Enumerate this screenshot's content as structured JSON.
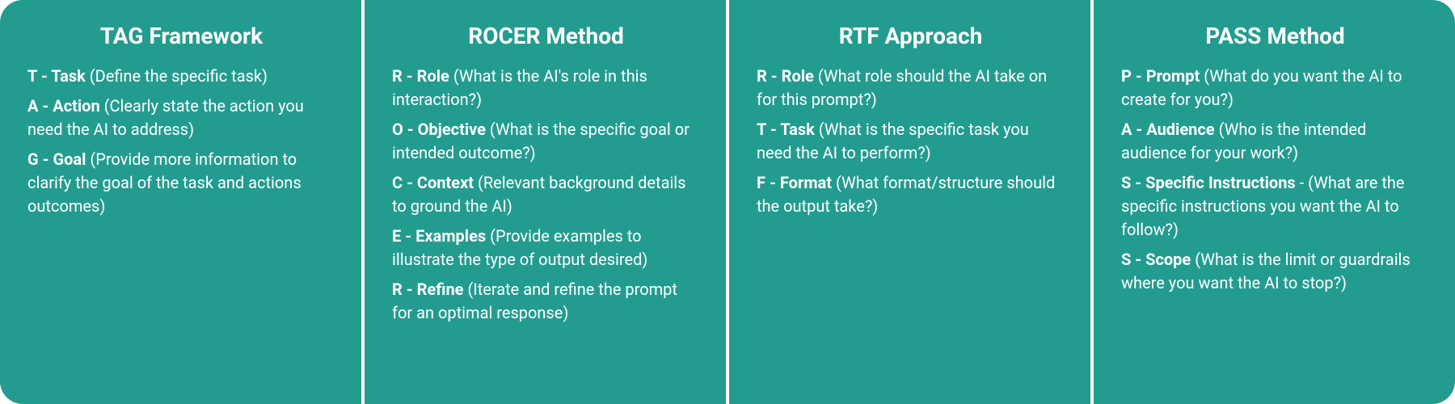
{
  "frameworks": [
    {
      "title": "TAG Framework",
      "items": [
        {
          "letter": "T",
          "word": "Task",
          "desc": "(Define the specific task)"
        },
        {
          "letter": "A",
          "word": "Action",
          "desc": "(Clearly state the action you need the AI to address)"
        },
        {
          "letter": "G",
          "word": "Goal",
          "desc": "(Provide more information to clarify the goal of the task and actions outcomes)"
        }
      ]
    },
    {
      "title": "ROCER Method",
      "items": [
        {
          "letter": "R",
          "word": "Role",
          "desc": "(What is the AI's role in this interaction?)"
        },
        {
          "letter": "O",
          "word": "Objective",
          "desc": "(What is the specific goal or intended outcome?)"
        },
        {
          "letter": "C",
          "word": "Context",
          "desc": "(Relevant background details to ground the AI)"
        },
        {
          "letter": "E",
          "word": "Examples",
          "desc": "(Provide examples to illustrate the type of output desired)"
        },
        {
          "letter": "R",
          "word": "Refine",
          "desc": "(Iterate and refine the prompt for an optimal response)"
        }
      ]
    },
    {
      "title": "RTF Approach",
      "items": [
        {
          "letter": "R",
          "word": "Role",
          "desc": "(What role should the AI take on for this prompt?)"
        },
        {
          "letter": "T",
          "word": "Task",
          "desc": "(What is the specific task you need the AI to perform?)"
        },
        {
          "letter": "F",
          "word": "Format",
          "desc": "(What format/structure should the output take?)"
        }
      ]
    },
    {
      "title": "PASS Method",
      "items": [
        {
          "letter": "P",
          "word": "Prompt",
          "desc": "(What do you want the AI to create for you?)"
        },
        {
          "letter": "A",
          "word": "Audience",
          "desc": "(Who is the intended audience for your work?)"
        },
        {
          "letter": "S",
          "word": "Specific Instructions",
          "desc": "- (What are the specific instructions you want the AI to follow?)"
        },
        {
          "letter": "S",
          "word": "Scope",
          "desc": "(What is the limit or guardrails where you want the AI to stop?)"
        }
      ]
    }
  ]
}
